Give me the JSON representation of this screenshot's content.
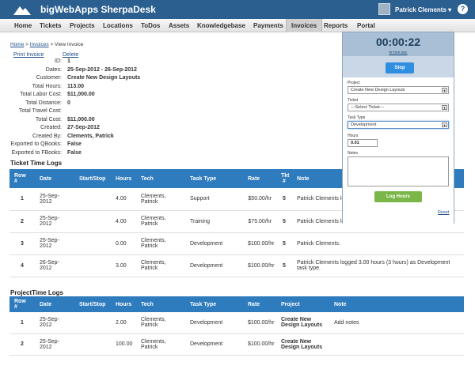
{
  "header": {
    "brand": "bigWebApps SherpaDesk",
    "user_name": "Patrick Clements",
    "user_caret": "▾",
    "help": "?"
  },
  "nav": [
    "Home",
    "Tickets",
    "Projects",
    "Locations",
    "ToDos",
    "Assets",
    "Knowledgebase",
    "Payments",
    "Invoices",
    "Reports",
    "Portal"
  ],
  "nav_active": "Invoices",
  "breadcrumb": {
    "home": "Home",
    "invoices": "Invoices",
    "current": "View Invoice",
    "separator": ">"
  },
  "actions": {
    "print": "Print Invoice",
    "delete": "Delete"
  },
  "invoice": [
    {
      "label": "ID:",
      "value": "1"
    },
    {
      "label": "Dates:",
      "value": "25-Sep-2012 - 26-Sep-2012"
    },
    {
      "label": "Customer:",
      "value": "Create New Design Layouts"
    },
    {
      "label": "Total Hours:",
      "value": "113.00"
    },
    {
      "label": "Total Labor Cost:",
      "value": "$11,000.00"
    },
    {
      "label": "Total Distance:",
      "value": "0"
    },
    {
      "label": "Total Travel Cost:",
      "value": ""
    },
    {
      "label": "Total Cost:",
      "value": "$11,000.00"
    },
    {
      "label": "Created:",
      "value": "27-Sep-2012"
    },
    {
      "label": "Created By:",
      "value": "Clements, Patrick"
    },
    {
      "label": "Exported to QBooks:",
      "value": "False"
    },
    {
      "label": "Exported to FBooks:",
      "value": "False"
    }
  ],
  "ticket_logs": {
    "title": "Ticket Time Logs",
    "columns": [
      "Row #",
      "Date",
      "Start/Stop",
      "Hours",
      "Tech",
      "Task Type",
      "Rate",
      "Tkt #",
      "Note"
    ],
    "rows": [
      {
        "row": "1",
        "date": "25-Sep-2012",
        "startstop": "",
        "hours": "4.00",
        "tech": "Clements, Patrick",
        "task": "Support",
        "rate": "$50.00/hr",
        "tkt": "5",
        "note": "Patrick Clements lo"
      },
      {
        "row": "2",
        "date": "25-Sep-2012",
        "startstop": "",
        "hours": "4.00",
        "tech": "Clements, Patrick",
        "task": "Training",
        "rate": "$75.00/hr",
        "tkt": "5",
        "note": "Patrick Clements lo and estimated 3.00"
      },
      {
        "row": "3",
        "date": "25-Sep-2012",
        "startstop": "",
        "hours": "0.00",
        "tech": "Clements, Patrick",
        "task": "Development",
        "rate": "$100.00/hr",
        "tkt": "5",
        "note": "Patrick Clements."
      },
      {
        "row": "4",
        "date": "26-Sep-2012",
        "startstop": "",
        "hours": "3.00",
        "tech": "Clements, Patrick",
        "task": "Development",
        "rate": "$100.00/hr",
        "tkt": "5",
        "note": "Patrick Clements logged 3.00 hours (3 hours) as Development task type."
      }
    ]
  },
  "project_logs": {
    "title": "ProjectTime Logs",
    "columns": [
      "Row #",
      "Date",
      "Start/Stop",
      "Hours",
      "Tech",
      "Task Type",
      "Rate",
      "Project",
      "Note"
    ],
    "rows": [
      {
        "row": "1",
        "date": "25-Sep-2012",
        "startstop": "",
        "hours": "2.00",
        "tech": "Clements, Patrick",
        "task": "Development",
        "rate": "$100.00/hr",
        "project": "Create New Design Layouts",
        "note": "Add notes"
      },
      {
        "row": "2",
        "date": "25-Sep-2012",
        "startstop": "",
        "hours": "100.00",
        "tech": "Clements, Patrick",
        "task": "Development",
        "rate": "$100.00/hr",
        "project": "Create New Design Layouts",
        "note": ""
      }
    ]
  },
  "timer": {
    "time": "00:00:22",
    "subtitle": "hr:min:sec",
    "stop": "Stop",
    "project_label": "Project",
    "project_value": "Create New Design Layouts",
    "ticket_label": "Ticket",
    "ticket_value": "---Select Ticket---",
    "tasktype_label": "Task Type",
    "tasktype_value": "Development",
    "hours_label": "Hours",
    "hours_value": "0.01",
    "notes_label": "Notes",
    "log_button": "Log Hours",
    "reset": "Reset"
  },
  "colors": {
    "topbar": "#2b5f8f",
    "table_header": "#2e7bbd",
    "stop_button": "#2f8ee0",
    "log_button": "#7ab648"
  }
}
